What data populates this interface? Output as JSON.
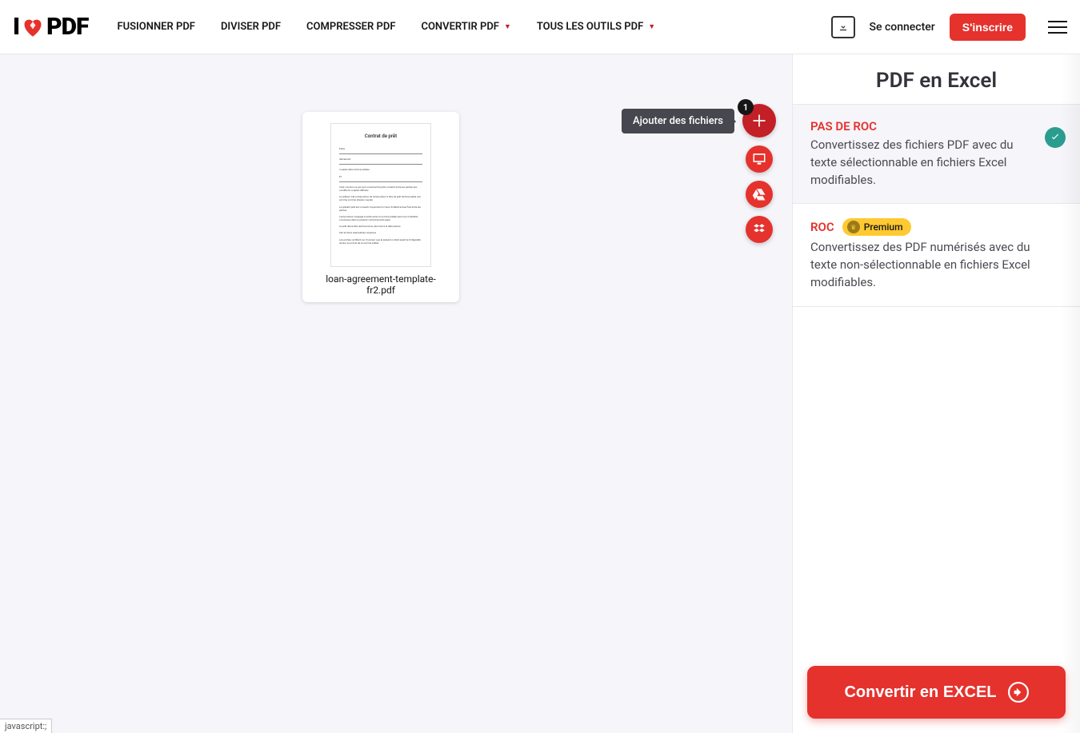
{
  "logo": {
    "left": "I",
    "right": "PDF"
  },
  "nav": {
    "merge": "FUSIONNER PDF",
    "split": "DIVISER PDF",
    "compress": "COMPRESSER PDF",
    "convert": "CONVERTIR PDF",
    "all": "TOUS LES OUTILS PDF"
  },
  "header": {
    "login": "Se connecter",
    "signup": "S'inscrire"
  },
  "file": {
    "name": "loan-agreement-template-fr2.pdf",
    "doc_title": "Contrat de prêt"
  },
  "fab": {
    "tooltip": "Ajouter des fichiers",
    "badge": "1"
  },
  "sidebar": {
    "title": "PDF en Excel",
    "opt1_title": "PAS DE ROC",
    "opt1_desc": "Convertissez des fichiers PDF avec du texte sélectionnable en fichiers Excel modifiables.",
    "opt2_title": "ROC",
    "opt2_desc": "Convertissez des PDF numérisés avec du texte non-sélectionnable en fichiers Excel modifiables.",
    "premium": "Premium",
    "convert": "Convertir en EXCEL"
  },
  "status": "javascript:;"
}
